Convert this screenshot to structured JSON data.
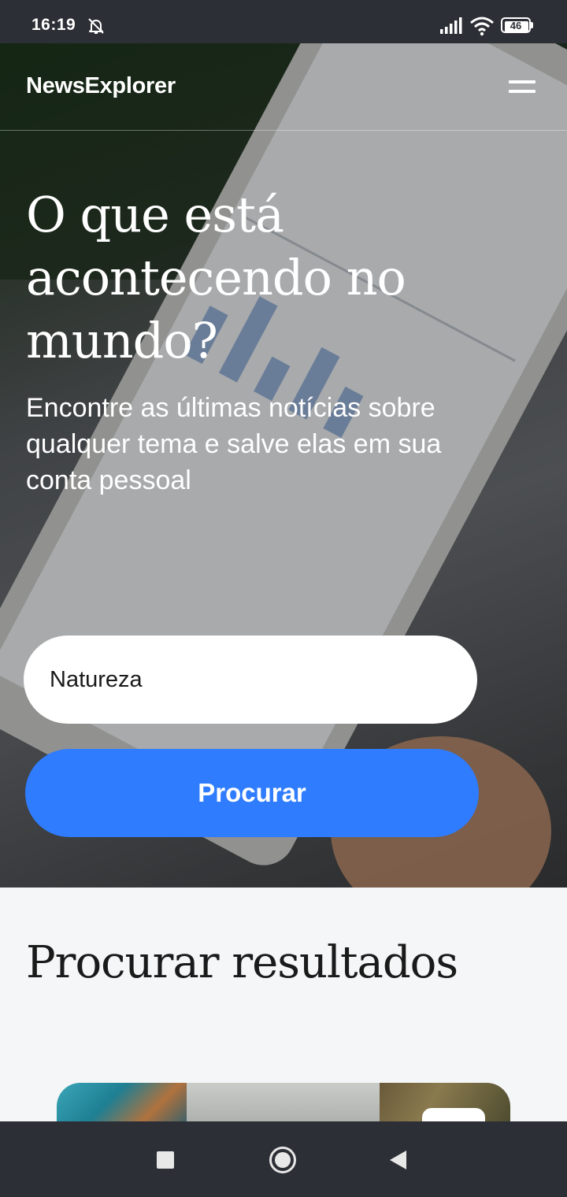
{
  "status_bar": {
    "time": "16:19",
    "battery_level": "46",
    "icons": [
      "bell-muted-icon",
      "signal-icon",
      "wifi-icon",
      "battery-icon"
    ]
  },
  "header": {
    "brand": "NewsExplorer",
    "menu_icon": "hamburger-menu-icon"
  },
  "hero": {
    "title": "O que está acontecendo no mundo?",
    "subtitle": "Encontre as últimas notícias sobre qualquer tema e salve elas em sua conta pessoal",
    "search": {
      "value": "Natureza"
    },
    "search_button_label": "Procurar",
    "accent_color": "#2f7cff"
  },
  "results": {
    "title": "Procurar resultados"
  },
  "nav_bar": {
    "icons": [
      "recent-apps-icon",
      "home-icon",
      "back-icon"
    ]
  }
}
